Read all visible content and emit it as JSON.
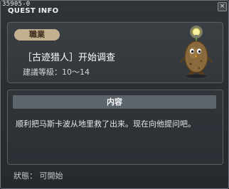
{
  "window": {
    "quest_id": "35905-0",
    "title": "QUEST INFO",
    "close_symbol": "×"
  },
  "quest": {
    "job_badge": "職業",
    "name": "［古迹猎人］开始调查",
    "level": "建議等級：10〜14"
  },
  "content": {
    "header": "内容",
    "text": "顺利把马斯卡波从地里救了出来。现在向他提问吧。"
  },
  "status": {
    "text": "狀態： 可開始"
  },
  "icons": {
    "npc": "potato-npc-with-lightbulb"
  }
}
